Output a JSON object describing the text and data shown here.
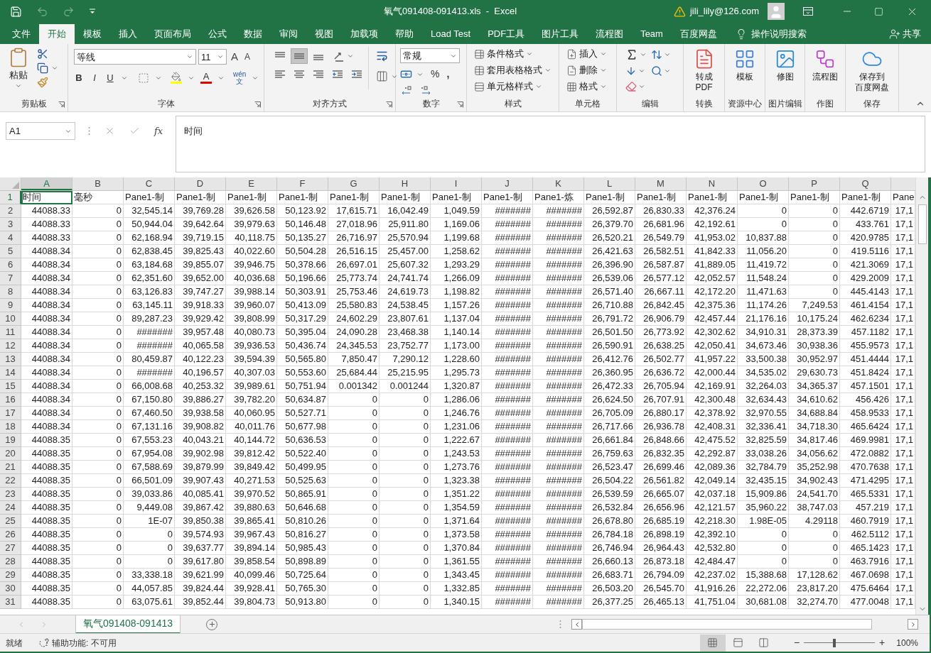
{
  "title_bar": {
    "title": "氧气091408-091413.xls  -  Excel",
    "account": "jili_lily@126.com",
    "quick_access": [
      {
        "kind": "save",
        "disabled": false
      },
      {
        "kind": "undo",
        "disabled": true
      },
      {
        "kind": "redo",
        "disabled": true
      },
      {
        "kind": "customize",
        "disabled": false
      }
    ]
  },
  "menu_tabs": [
    {
      "label": "文件",
      "selected": false
    },
    {
      "label": "开始",
      "selected": true
    },
    {
      "label": "模板",
      "selected": false
    },
    {
      "label": "插入",
      "selected": false
    },
    {
      "label": "页面布局",
      "selected": false
    },
    {
      "label": "公式",
      "selected": false
    },
    {
      "label": "数据",
      "selected": false
    },
    {
      "label": "审阅",
      "selected": false
    },
    {
      "label": "视图",
      "selected": false
    },
    {
      "label": "加载项",
      "selected": false
    },
    {
      "label": "帮助",
      "selected": false
    },
    {
      "label": "Load Test",
      "selected": false
    },
    {
      "label": "PDF工具",
      "selected": false
    },
    {
      "label": "图片工具",
      "selected": false
    },
    {
      "label": "流程图",
      "selected": false
    },
    {
      "label": "Team",
      "selected": false
    },
    {
      "label": "百度网盘",
      "selected": false
    }
  ],
  "tell_me": "操作说明搜索",
  "share": "共享",
  "ribbon": {
    "clipboard": {
      "label": "剪贴板",
      "paste": "粘贴"
    },
    "font": {
      "label": "字体",
      "font_name": "等线",
      "font_size": "11",
      "grow": "A",
      "shrink": "A",
      "bold": "B",
      "italic": "I",
      "underline": "U",
      "font_color": "A",
      "phonetic_top": "wén",
      "phonetic_bottom": "文"
    },
    "alignment": {
      "label": "对齐方式",
      "buttons": [
        {
          "kind": "top",
          "selected": false
        },
        {
          "kind": "middle",
          "selected": true
        },
        {
          "kind": "bottom",
          "selected": false
        },
        {
          "kind": "left",
          "selected": false
        },
        {
          "kind": "center",
          "selected": false
        },
        {
          "kind": "right",
          "selected": false
        },
        {
          "kind": "outdent",
          "selected": false
        },
        {
          "kind": "indent",
          "selected": false
        }
      ]
    },
    "number": {
      "label": "数字",
      "format": "常规",
      "percent": "%",
      "comma": ","
    },
    "styles": {
      "label": "样式",
      "items": [
        "条件格式",
        "套用表格格式",
        "单元格样式"
      ]
    },
    "cells": {
      "label": "单元格",
      "items": [
        "插入",
        "删除",
        "格式"
      ]
    },
    "editing": {
      "label": "编辑"
    },
    "large_groups": [
      {
        "kind": "pdf",
        "label": "转换",
        "lines": [
          "转成",
          "PDF"
        ]
      },
      {
        "kind": "template",
        "label": "资源中心",
        "lines": [
          "模板"
        ]
      },
      {
        "kind": "image_edit",
        "label": "图片编辑",
        "lines": [
          "修图"
        ]
      },
      {
        "kind": "flowchart",
        "label": "作图",
        "lines": [
          "流程图"
        ]
      },
      {
        "kind": "cloud",
        "label": "保存",
        "lines": [
          "保存到",
          "百度网盘"
        ]
      }
    ]
  },
  "formula_bar": {
    "name_box": "A1",
    "function_button": "fx",
    "content": "时间"
  },
  "sheet": {
    "columns": [
      {
        "label": "A",
        "selected": true
      },
      {
        "label": "B",
        "selected": false
      },
      {
        "label": "C",
        "selected": false
      },
      {
        "label": "D",
        "selected": false
      },
      {
        "label": "E",
        "selected": false
      },
      {
        "label": "F",
        "selected": false
      },
      {
        "label": "G",
        "selected": false
      },
      {
        "label": "H",
        "selected": false
      },
      {
        "label": "I",
        "selected": false
      },
      {
        "label": "J",
        "selected": false
      },
      {
        "label": "K",
        "selected": false
      },
      {
        "label": "L",
        "selected": false
      },
      {
        "label": "M",
        "selected": false
      },
      {
        "label": "N",
        "selected": false
      },
      {
        "label": "O",
        "selected": false
      },
      {
        "label": "P",
        "selected": false
      },
      {
        "label": "Q",
        "selected": false
      }
    ],
    "rows": [
      {
        "number": "1",
        "selected": true,
        "kind": "text",
        "cells": [
          "时间",
          "毫秒",
          "Pane1-制",
          "Pane1-制",
          "Pane1-制",
          "Pane1-制",
          "Pane1-制",
          "Pane1-制",
          "Pane1-制",
          "Pane1-制",
          "Pane1-炼",
          "Pane1-制",
          "Pane1-制",
          "Pane1-制",
          "Pane1-制",
          "Pane1-制",
          "Pane1-制",
          "Pane"
        ]
      },
      {
        "number": "2",
        "selected": false,
        "kind": "number",
        "cells": [
          "44088.33",
          "0",
          "32,545.14",
          "39,769.28",
          "39,626.58",
          "50,123.92",
          "17,615.71",
          "16,042.49",
          "1,049.59",
          "#######",
          "#######",
          "26,592.87",
          "26,830.33",
          "42,376.24",
          "0",
          "0",
          "442.6719",
          "17,1"
        ]
      },
      {
        "number": "3",
        "selected": false,
        "kind": "number",
        "cells": [
          "44088.33",
          "0",
          "50,944.04",
          "39,642.64",
          "39,979.63",
          "50,146.48",
          "27,018.96",
          "25,911.80",
          "1,169.06",
          "#######",
          "#######",
          "26,379.70",
          "26,681.96",
          "42,192.61",
          "0",
          "0",
          "433.761",
          "17,1"
        ]
      },
      {
        "number": "4",
        "selected": false,
        "kind": "number",
        "cells": [
          "44088.33",
          "0",
          "62,168.94",
          "39,719.15",
          "40,118.75",
          "50,135.27",
          "26,716.97",
          "25,570.94",
          "1,199.68",
          "#######",
          "#######",
          "26,520.21",
          "26,549.79",
          "41,953.02",
          "10,837.88",
          "0",
          "420.9785",
          "17,1"
        ]
      },
      {
        "number": "5",
        "selected": false,
        "kind": "number",
        "cells": [
          "44088.34",
          "0",
          "62,838.45",
          "39,825.43",
          "40,022.60",
          "50,504.28",
          "26,516.15",
          "25,457.00",
          "1,258.62",
          "#######",
          "#######",
          "26,421.63",
          "26,582.51",
          "41,842.33",
          "11,056.20",
          "0",
          "419.5116",
          "17,1"
        ]
      },
      {
        "number": "6",
        "selected": false,
        "kind": "number",
        "cells": [
          "44088.34",
          "0",
          "63,184.68",
          "39,855.07",
          "39,946.75",
          "50,378.66",
          "26,697.01",
          "25,607.32",
          "1,293.29",
          "#######",
          "#######",
          "26,396.90",
          "26,587.87",
          "41,889.05",
          "11,419.72",
          "0",
          "421.3069",
          "17,1"
        ]
      },
      {
        "number": "7",
        "selected": false,
        "kind": "number",
        "cells": [
          "44088.34",
          "0",
          "62,351.60",
          "39,652.00",
          "40,036.68",
          "50,196.66",
          "25,773.74",
          "24,741.74",
          "1,266.09",
          "#######",
          "#######",
          "26,539.06",
          "26,577.12",
          "42,052.57",
          "11,548.24",
          "0",
          "429.2009",
          "17,1"
        ]
      },
      {
        "number": "8",
        "selected": false,
        "kind": "number",
        "cells": [
          "44088.34",
          "0",
          "63,126.83",
          "39,747.27",
          "39,988.14",
          "50,303.91",
          "25,753.46",
          "24,619.73",
          "1,198.82",
          "#######",
          "#######",
          "26,571.40",
          "26,667.11",
          "42,172.20",
          "11,471.63",
          "0",
          "445.4143",
          "17,1"
        ]
      },
      {
        "number": "9",
        "selected": false,
        "kind": "number",
        "cells": [
          "44088.34",
          "0",
          "63,145.11",
          "39,918.33",
          "39,960.07",
          "50,413.09",
          "25,580.83",
          "24,538.45",
          "1,157.26",
          "#######",
          "#######",
          "26,710.88",
          "26,842.45",
          "42,375.36",
          "11,174.26",
          "7,249.53",
          "461.4154",
          "17,1"
        ]
      },
      {
        "number": "10",
        "selected": false,
        "kind": "number",
        "cells": [
          "44088.34",
          "0",
          "89,287.23",
          "39,929.42",
          "39,808.99",
          "50,317.29",
          "24,602.29",
          "23,807.61",
          "1,137.04",
          "#######",
          "#######",
          "26,791.72",
          "26,906.79",
          "42,457.44",
          "21,176.16",
          "10,175.24",
          "462.6234",
          "17,1"
        ]
      },
      {
        "number": "11",
        "selected": false,
        "kind": "number",
        "cells": [
          "44088.34",
          "0",
          "#######",
          "39,957.48",
          "40,080.73",
          "50,395.04",
          "24,090.28",
          "23,468.38",
          "1,140.14",
          "#######",
          "#######",
          "26,501.50",
          "26,773.92",
          "42,302.62",
          "34,910.31",
          "28,373.39",
          "457.1182",
          "17,1"
        ]
      },
      {
        "number": "12",
        "selected": false,
        "kind": "number",
        "cells": [
          "44088.34",
          "0",
          "#######",
          "40,065.58",
          "39,936.53",
          "50,436.74",
          "24,345.53",
          "23,752.77",
          "1,173.00",
          "#######",
          "#######",
          "26,590.91",
          "26,638.25",
          "42,050.41",
          "34,673.46",
          "30,938.36",
          "455.9573",
          "17,1"
        ]
      },
      {
        "number": "13",
        "selected": false,
        "kind": "number",
        "cells": [
          "44088.34",
          "0",
          "80,459.87",
          "40,122.23",
          "39,594.39",
          "50,565.80",
          "7,850.47",
          "7,290.12",
          "1,228.60",
          "#######",
          "#######",
          "26,412.76",
          "26,502.77",
          "41,957.22",
          "33,500.38",
          "30,952.97",
          "451.4444",
          "17,1"
        ]
      },
      {
        "number": "14",
        "selected": false,
        "kind": "number",
        "cells": [
          "44088.34",
          "0",
          "#######",
          "40,196.57",
          "40,307.03",
          "50,553.60",
          "25,684.44",
          "25,215.95",
          "1,295.73",
          "#######",
          "#######",
          "26,360.95",
          "26,636.72",
          "42,000.44",
          "34,535.02",
          "29,630.73",
          "451.8424",
          "17,1"
        ]
      },
      {
        "number": "15",
        "selected": false,
        "kind": "number",
        "cells": [
          "44088.34",
          "0",
          "66,008.68",
          "40,253.32",
          "39,989.61",
          "50,751.94",
          "0.001342",
          "0.001244",
          "1,320.87",
          "#######",
          "#######",
          "26,472.33",
          "26,705.94",
          "42,169.91",
          "32,264.03",
          "34,365.37",
          "457.1501",
          "17,1"
        ]
      },
      {
        "number": "16",
        "selected": false,
        "kind": "number",
        "cells": [
          "44088.34",
          "0",
          "67,150.80",
          "39,886.27",
          "39,782.20",
          "50,634.87",
          "0",
          "0",
          "1,286.06",
          "#######",
          "#######",
          "26,624.50",
          "26,707.91",
          "42,300.48",
          "32,634.43",
          "34,610.62",
          "456.426",
          "17,1"
        ]
      },
      {
        "number": "17",
        "selected": false,
        "kind": "number",
        "cells": [
          "44088.34",
          "0",
          "67,460.50",
          "39,938.58",
          "40,060.95",
          "50,527.71",
          "0",
          "0",
          "1,246.76",
          "#######",
          "#######",
          "26,705.09",
          "26,880.17",
          "42,378.92",
          "32,970.55",
          "34,688.84",
          "458.9533",
          "17,1"
        ]
      },
      {
        "number": "18",
        "selected": false,
        "kind": "number",
        "cells": [
          "44088.34",
          "0",
          "67,131.16",
          "39,908.82",
          "40,011.76",
          "50,677.98",
          "0",
          "0",
          "1,231.06",
          "#######",
          "#######",
          "26,717.66",
          "26,936.78",
          "42,408.31",
          "32,336.41",
          "34,718.30",
          "465.6424",
          "17,1"
        ]
      },
      {
        "number": "19",
        "selected": false,
        "kind": "number",
        "cells": [
          "44088.35",
          "0",
          "67,553.23",
          "40,043.21",
          "40,144.72",
          "50,636.53",
          "0",
          "0",
          "1,222.67",
          "#######",
          "#######",
          "26,661.84",
          "26,848.66",
          "42,475.52",
          "32,825.59",
          "34,817.46",
          "469.9981",
          "17,1"
        ]
      },
      {
        "number": "20",
        "selected": false,
        "kind": "number",
        "cells": [
          "44088.35",
          "0",
          "67,954.08",
          "39,902.98",
          "39,812.42",
          "50,522.40",
          "0",
          "0",
          "1,243.53",
          "#######",
          "#######",
          "26,759.63",
          "26,832.35",
          "42,292.87",
          "33,038.26",
          "34,056.62",
          "472.0882",
          "17,1"
        ]
      },
      {
        "number": "21",
        "selected": false,
        "kind": "number",
        "cells": [
          "44088.35",
          "0",
          "67,588.69",
          "39,879.99",
          "39,849.42",
          "50,499.95",
          "0",
          "0",
          "1,273.76",
          "#######",
          "#######",
          "26,523.47",
          "26,699.46",
          "42,089.36",
          "32,784.79",
          "35,252.98",
          "470.7638",
          "17,1"
        ]
      },
      {
        "number": "22",
        "selected": false,
        "kind": "number",
        "cells": [
          "44088.35",
          "0",
          "66,501.09",
          "39,907.43",
          "40,271.53",
          "50,525.63",
          "0",
          "0",
          "1,323.38",
          "#######",
          "#######",
          "26,504.22",
          "26,561.82",
          "42,049.14",
          "32,435.15",
          "34,902.43",
          "471.4295",
          "17,1"
        ]
      },
      {
        "number": "23",
        "selected": false,
        "kind": "number",
        "cells": [
          "44088.35",
          "0",
          "39,033.86",
          "40,085.41",
          "39,970.52",
          "50,865.91",
          "0",
          "0",
          "1,351.22",
          "#######",
          "#######",
          "26,539.59",
          "26,665.07",
          "42,037.18",
          "15,909.86",
          "24,541.70",
          "465.5331",
          "17,1"
        ]
      },
      {
        "number": "24",
        "selected": false,
        "kind": "number",
        "cells": [
          "44088.35",
          "0",
          "9,449.08",
          "39,867.42",
          "39,880.63",
          "50,646.68",
          "0",
          "0",
          "1,354.59",
          "#######",
          "#######",
          "26,532.84",
          "26,656.96",
          "42,121.57",
          "35,960.22",
          "38,747.03",
          "457.219",
          "17,1"
        ]
      },
      {
        "number": "25",
        "selected": false,
        "kind": "number",
        "cells": [
          "44088.35",
          "0",
          "1E-07",
          "39,850.38",
          "39,865.41",
          "50,810.26",
          "0",
          "0",
          "1,371.64",
          "#######",
          "#######",
          "26,678.80",
          "26,685.19",
          "42,218.30",
          "1.98E-05",
          "4.29118",
          "460.7919",
          "17,1"
        ]
      },
      {
        "number": "26",
        "selected": false,
        "kind": "number",
        "cells": [
          "44088.35",
          "0",
          "0",
          "39,574.93",
          "39,967.43",
          "50,816.27",
          "0",
          "0",
          "1,373.58",
          "#######",
          "#######",
          "26,784.18",
          "26,898.19",
          "42,392.10",
          "0",
          "0",
          "462.5112",
          "17,1"
        ]
      },
      {
        "number": "27",
        "selected": false,
        "kind": "number",
        "cells": [
          "44088.35",
          "0",
          "0",
          "39,637.77",
          "39,894.14",
          "50,985.43",
          "0",
          "0",
          "1,370.84",
          "#######",
          "#######",
          "26,746.94",
          "26,964.43",
          "42,532.80",
          "0",
          "0",
          "465.1423",
          "17,1"
        ]
      },
      {
        "number": "28",
        "selected": false,
        "kind": "number",
        "cells": [
          "44088.35",
          "0",
          "0",
          "39,617.80",
          "39,858.54",
          "50,898.89",
          "0",
          "0",
          "1,361.55",
          "#######",
          "#######",
          "26,660.13",
          "26,873.18",
          "42,484.47",
          "0",
          "0",
          "463.7916",
          "17,1"
        ]
      },
      {
        "number": "29",
        "selected": false,
        "kind": "number",
        "cells": [
          "44088.35",
          "0",
          "33,338.18",
          "39,621.99",
          "40,099.46",
          "50,725.64",
          "0",
          "0",
          "1,343.45",
          "#######",
          "#######",
          "26,683.71",
          "26,794.09",
          "42,237.02",
          "15,388.68",
          "17,128.62",
          "467.0698",
          "17,1"
        ]
      },
      {
        "number": "30",
        "selected": false,
        "kind": "number",
        "cells": [
          "44088.35",
          "0",
          "44,057.85",
          "39,824.44",
          "39,928.41",
          "50,765.30",
          "0",
          "0",
          "1,332.85",
          "#######",
          "#######",
          "26,503.20",
          "26,545.70",
          "41,916.26",
          "22,272.06",
          "23,817.20",
          "475.6464",
          "17,1"
        ]
      },
      {
        "number": "31",
        "selected": false,
        "kind": "number",
        "cells": [
          "44088.35",
          "0",
          "63,075.61",
          "39,852.44",
          "39,804.73",
          "50,913.80",
          "0",
          "0",
          "1,340.15",
          "#######",
          "#######",
          "26,377.25",
          "26,465.13",
          "41,751.04",
          "30,681.08",
          "32,274.70",
          "477.0048",
          "17,1"
        ]
      }
    ]
  },
  "sheet_tabs": [
    {
      "label": "氧气091408-091413",
      "selected": true
    }
  ],
  "status_bar": {
    "ready": "就绪",
    "accessibility": "辅助功能: 不可用",
    "views": [
      {
        "kind": "normal",
        "selected": true
      },
      {
        "kind": "page_layout",
        "selected": false
      },
      {
        "kind": "page_break",
        "selected": false
      }
    ],
    "zoom_out": "−",
    "zoom_in": "+",
    "zoom": {
      "level": 0.43
    },
    "zoom_text": "100%"
  }
}
